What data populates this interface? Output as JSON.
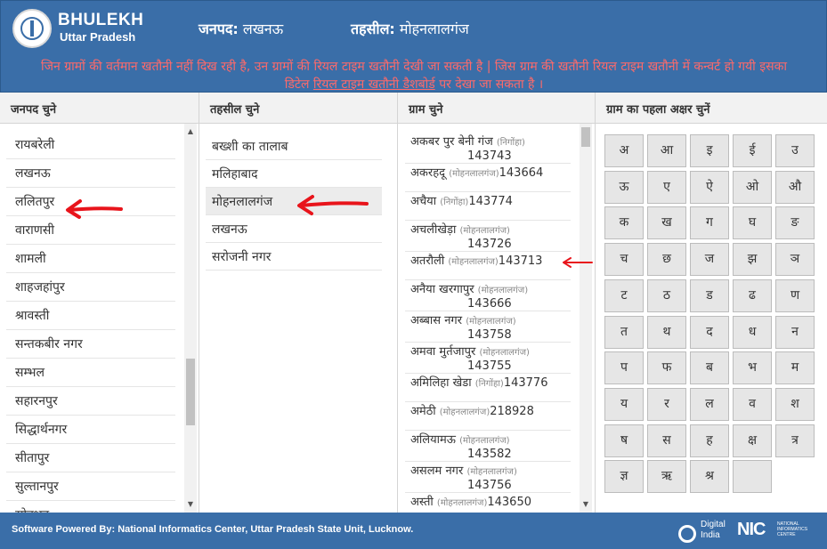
{
  "header": {
    "brand_title": "BHULEKH",
    "brand_subtitle": "Uttar Pradesh",
    "district_label": "जनपद:",
    "district_value": "लखनऊ",
    "tehsil_label": "तहसील:",
    "tehsil_value": "मोहनलालगंज",
    "notice_line1": "जिन ग्रामों की वर्तमान खतौनी नहीं दिख रही है, उन ग्रामों की रियल टाइम खतौनी देखी जा सकती है | जिस ग्राम की खतौनी रियल टाइम खतौनी में कन्वर्ट हो गयी इसका",
    "notice_line2_before": "डिटेल ",
    "notice_link": "रियल टाइम खतौनी डैशबोर्ड",
    "notice_line2_after": " पर देखा जा सकता है ।",
    "colors": {
      "header_bg": "#3a6ea8",
      "notice_text": "#ff6a6a"
    }
  },
  "columns": {
    "district": "जनपद चुने",
    "tehsil": "तहसील चुने",
    "village": "ग्राम चुने",
    "alphabet": "ग्राम का पहला अक्षर चुनें"
  },
  "districts": [
    "रायबरेली",
    "लखनऊ",
    "ललितपुर",
    "वाराणसी",
    "शामली",
    "शाहजहांपुर",
    "श्रावस्ती",
    "सन्तकबीर नगर",
    "सम्भल",
    "सहारनपुर",
    "सिद्धार्थनगर",
    "सीतापुर",
    "सुल्तानपुर",
    "सोनभद्र"
  ],
  "tehsils": [
    "बख्शी का तालाब",
    "मलिहाबाद",
    "मोहनलालगंज",
    "लखनऊ",
    "सरोजनी नगर"
  ],
  "selected_tehsil": "मोहनलालगंज",
  "villages": [
    {
      "name": "अकबर पुर बेनी गंज",
      "tehsil": "(निगोंहा)",
      "code": "143743",
      "wrap": true
    },
    {
      "name": "अकरहदू",
      "tehsil": "(मोहनलालगंज)",
      "code": "143664",
      "wrap": false
    },
    {
      "name": "अचैया",
      "tehsil": "(निगोंहा)",
      "code": "143774",
      "wrap": false
    },
    {
      "name": "अचलीखेड़ा",
      "tehsil": "(मोहनलालगंज)",
      "code": "143726",
      "wrap": true
    },
    {
      "name": "अतरौली",
      "tehsil": "(मोहनलालगंज)",
      "code": "143713",
      "wrap": false
    },
    {
      "name": "अनैया खरगापुर",
      "tehsil": "(मोहनलालगंज)",
      "code": "143666",
      "wrap": true
    },
    {
      "name": "अब्बास नगर",
      "tehsil": "(मोहनलालगंज)",
      "code": "143758",
      "wrap": true
    },
    {
      "name": "अमवा मुर्तजापुर",
      "tehsil": "(मोहनलालगंज)",
      "code": "143755",
      "wrap": true
    },
    {
      "name": "अमिलिहा खेडा",
      "tehsil": "(निगोंहा)",
      "code": "143776",
      "wrap": false
    },
    {
      "name": "अमेठी",
      "tehsil": "(मोहनलालगंज)",
      "code": "218928",
      "wrap": false
    },
    {
      "name": "अलियामऊ",
      "tehsil": "(मोहनलालगंज)",
      "code": "143582",
      "wrap": true
    },
    {
      "name": "असलम नगर",
      "tehsil": "(मोहनलालगंज)",
      "code": "143756",
      "wrap": true
    },
    {
      "name": "अस्ती",
      "tehsil": "(मोहनलालगंज)",
      "code": "143650",
      "wrap": false
    }
  ],
  "letters": [
    "अ",
    "आ",
    "इ",
    "ई",
    "उ",
    "ऊ",
    "ए",
    "ऐ",
    "ओ",
    "औ",
    "क",
    "ख",
    "ग",
    "घ",
    "ङ",
    "च",
    "छ",
    "ज",
    "झ",
    "ञ",
    "ट",
    "ठ",
    "ड",
    "ढ",
    "ण",
    "त",
    "थ",
    "द",
    "ध",
    "न",
    "प",
    "फ",
    "ब",
    "भ",
    "म",
    "य",
    "र",
    "ल",
    "व",
    "श",
    "ष",
    "स",
    "ह",
    "क्ष",
    "त्र",
    "ज्ञ",
    "ऋ",
    "श्र",
    ""
  ],
  "footer": {
    "powered_by": "Software Powered By: National Informatics Center, Uttar Pradesh State Unit, Lucknow.",
    "digital_line1": "Digital",
    "digital_line2": "India",
    "nic": "NIC",
    "nic_sub": "NATIONAL INFORMATICS CENTRE"
  },
  "scroll": {
    "district_position": 0.75,
    "village_position": 0.0
  },
  "annotation_color": "#e8141b"
}
